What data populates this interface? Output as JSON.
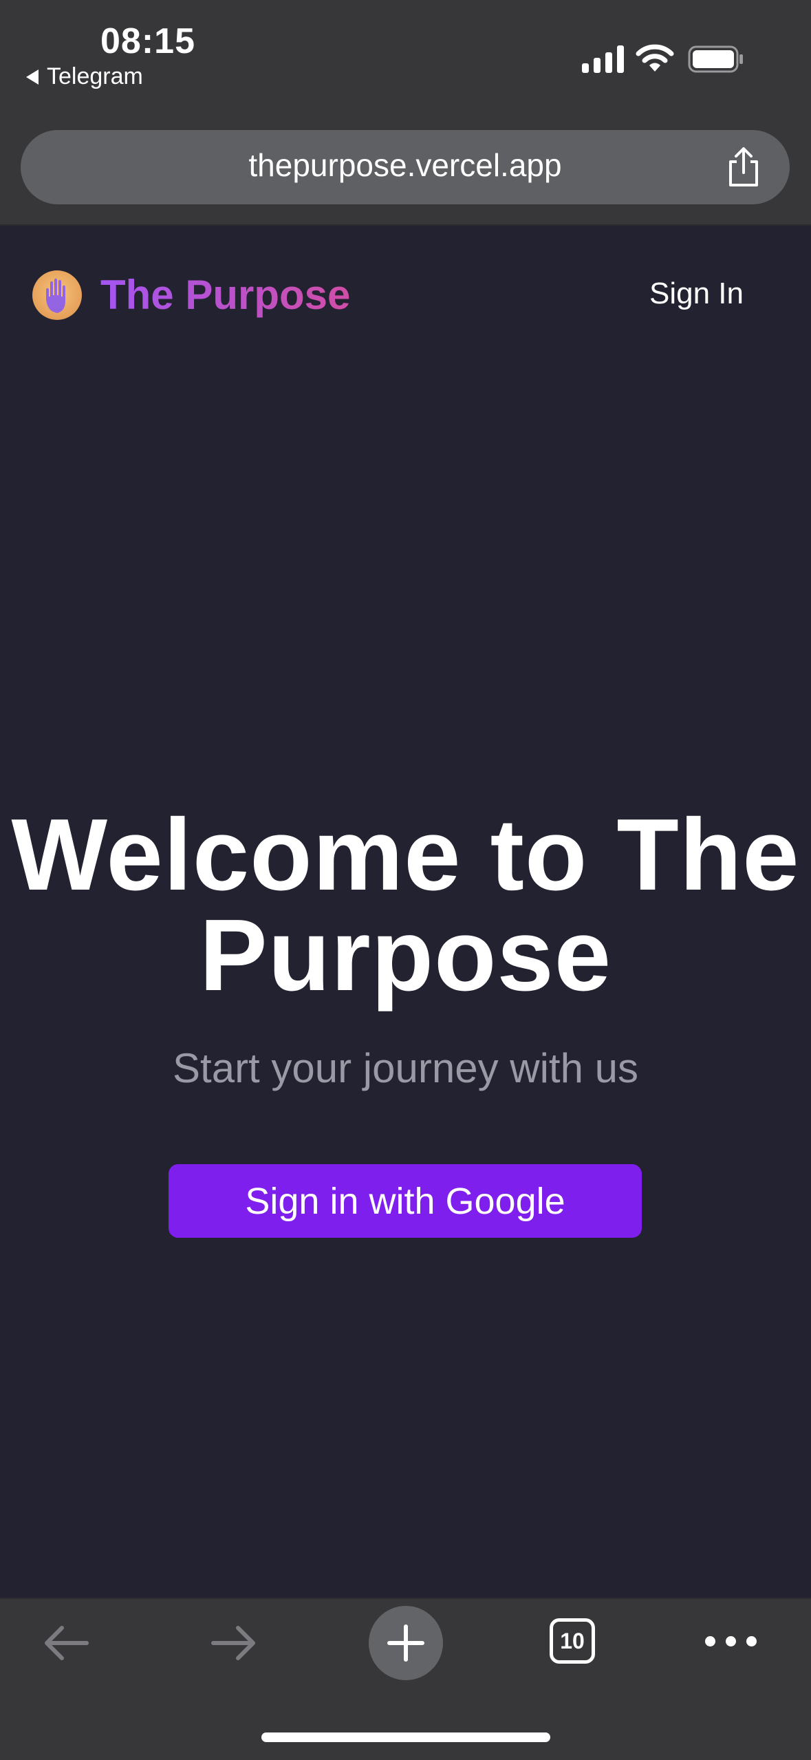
{
  "status_bar": {
    "time": "08:15",
    "back_app": "Telegram"
  },
  "browser": {
    "url": "thepurpose.vercel.app",
    "open_tabs": "10"
  },
  "header": {
    "brand": "The Purpose",
    "sign_in": "Sign In"
  },
  "hero": {
    "title_line1": "Welcome to The",
    "title_line2": "Purpose",
    "subtitle": "Start your journey with us",
    "cta": "Sign in with Google"
  },
  "colors": {
    "page_bg": "#222230",
    "chrome_bg": "#37373a",
    "cta_bg": "#7f1fee",
    "brand_gradient_start": "#a455f2",
    "brand_gradient_end": "#d04ea6"
  }
}
